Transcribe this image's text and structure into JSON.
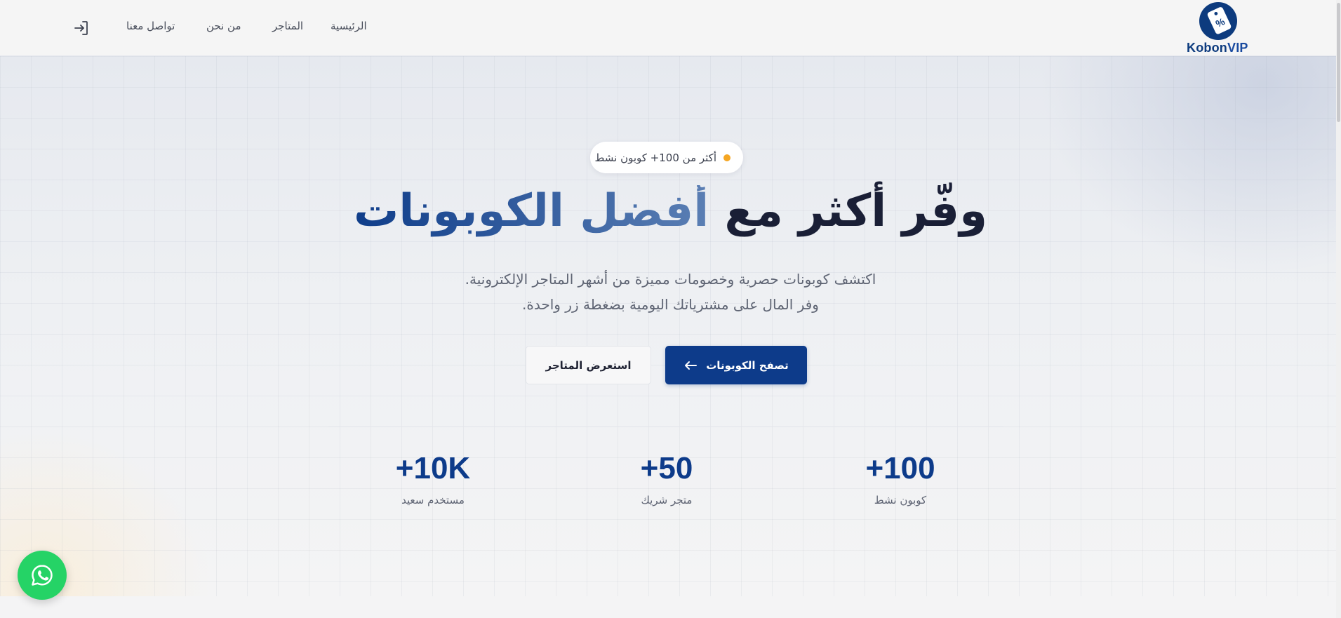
{
  "header": {
    "logo": {
      "text_main": "Kobon",
      "text_accent": "VIP",
      "icon": "coupon-tag-icon"
    },
    "nav": [
      {
        "id": "home",
        "label": "الرئيسية"
      },
      {
        "id": "stores",
        "label": "المتاجر"
      },
      {
        "id": "about",
        "label": "من نحن"
      },
      {
        "id": "contact",
        "label": "تواصل معنا"
      }
    ],
    "login_icon": "login-icon"
  },
  "hero": {
    "badge": "أكثر من 100+ كوبون نشط",
    "headline_plain": "وفّر أكثر مع ",
    "headline_accent": "أفضل الكوبونات",
    "subtitle_line1": "اكتشف كوبونات حصرية وخصومات مميزة من أشهر المتاجر الإلكترونية.",
    "subtitle_line2": "وفر المال على مشترياتك اليومية بضغطة زر واحدة.",
    "primary_button": {
      "label": "تصفح الكوبونات",
      "icon": "arrow-left-icon"
    },
    "secondary_button": {
      "label": "استعرض المتاجر"
    }
  },
  "stats": [
    {
      "value": "+100",
      "label": "كوبون نشط"
    },
    {
      "value": "+50",
      "label": "متجر شريك"
    },
    {
      "value": "+10K",
      "label": "مستخدم سعيد"
    }
  ],
  "floating": {
    "whatsapp_icon": "whatsapp-icon"
  },
  "colors": {
    "primary": "#0d3b8a",
    "accent_dot": "#f5a623",
    "whatsapp": "#25d366",
    "heading": "#1a1f36"
  }
}
